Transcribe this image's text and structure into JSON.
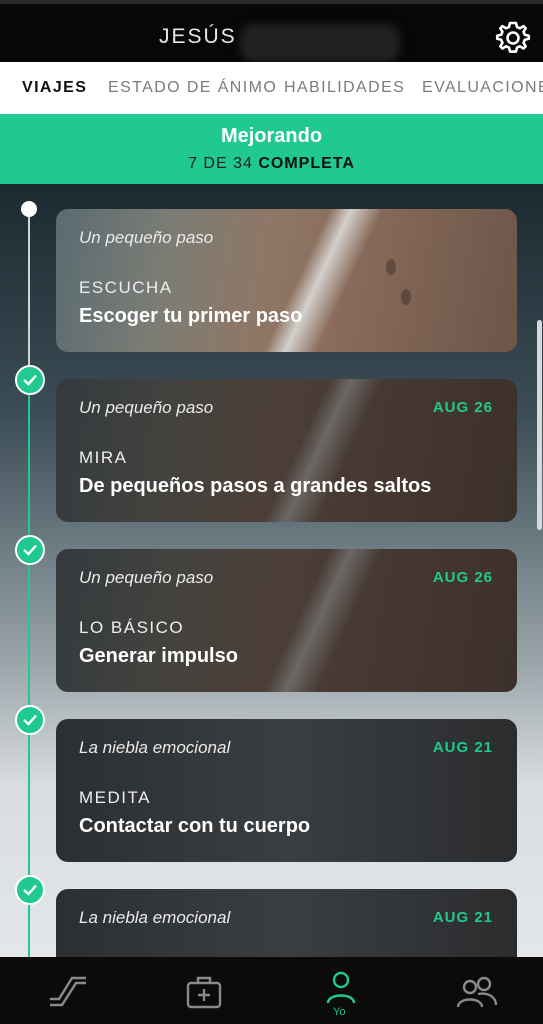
{
  "header": {
    "user_name": "JESÚS",
    "settings_icon": "gear-icon"
  },
  "tabs": [
    {
      "label": "VIAJES",
      "active": true
    },
    {
      "label": "ESTADO DE ÁNIMO",
      "active": false
    },
    {
      "label": "HABILIDADES",
      "active": false
    },
    {
      "label": "EVALUACIONE",
      "active": false
    }
  ],
  "banner": {
    "title": "Mejorando",
    "progress_prefix": "7 DE 34",
    "progress_status": "COMPLETA",
    "completed": 7,
    "total": 34
  },
  "cards": [
    {
      "subtitle": "Un pequeño paso",
      "type": "ESCUCHA",
      "title": "Escoger tu primer paso",
      "date": "",
      "completed": false
    },
    {
      "subtitle": "Un pequeño paso",
      "type": "MIRA",
      "title": "De pequeños pasos a grandes saltos",
      "date": "AUG 26",
      "completed": true
    },
    {
      "subtitle": "Un pequeño paso",
      "type": "LO BÁSICO",
      "title": "Generar impulso",
      "date": "AUG 26",
      "completed": true
    },
    {
      "subtitle": "La niebla emocional",
      "type": "MEDITA",
      "title": "Contactar con tu cuerpo",
      "date": "AUG 21",
      "completed": true
    },
    {
      "subtitle": "La niebla emocional",
      "type": "",
      "title": "",
      "date": "AUG 21",
      "completed": true
    }
  ],
  "bottom_nav": [
    {
      "icon": "journey-path-icon",
      "label": ""
    },
    {
      "icon": "medical-kit-icon",
      "label": ""
    },
    {
      "icon": "person-icon",
      "label": "Yo",
      "active": true
    },
    {
      "icon": "community-icon",
      "label": ""
    }
  ],
  "colors": {
    "accent": "#1fc98f",
    "header_bg": "#070707",
    "nav_bg": "#0b0b0b"
  }
}
